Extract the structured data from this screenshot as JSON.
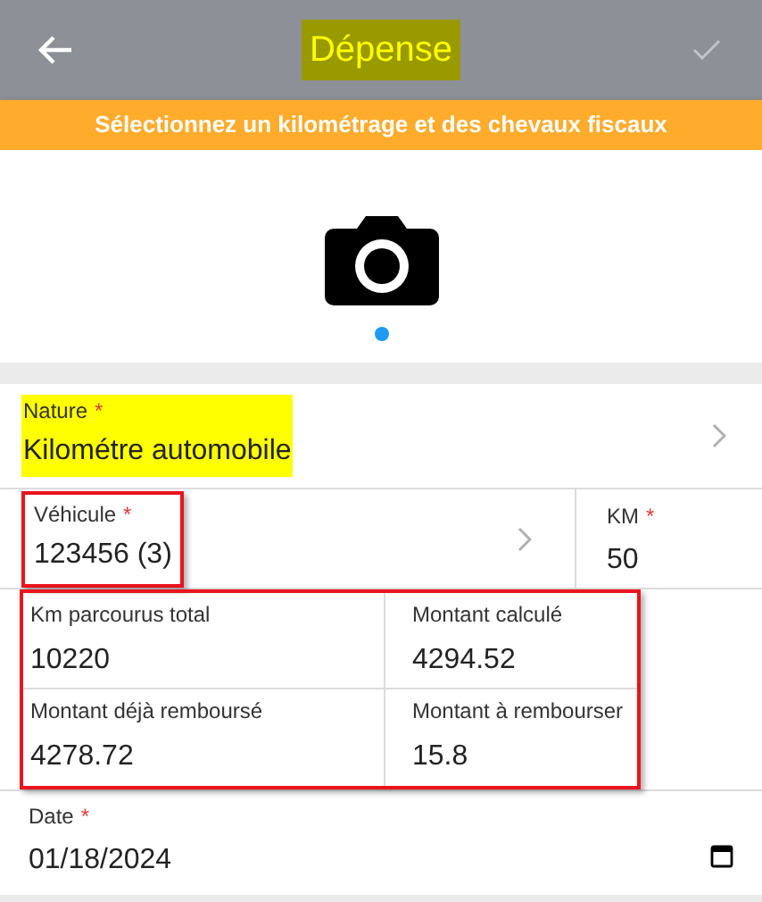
{
  "header": {
    "title": "Dépense",
    "title_highlighted": true,
    "confirm_disabled": true
  },
  "banner": {
    "text": "Sélectionnez un kilométrage et des chevaux fiscaux"
  },
  "photo": {
    "pages": [
      {
        "selected": true
      }
    ]
  },
  "nature": {
    "label": "Nature",
    "required_mark": "*",
    "value": "Kilométre automobile",
    "highlighted": true
  },
  "vehicle": {
    "label": "Véhicule",
    "required_mark": "*",
    "value": "123456 (3)",
    "outlined": true
  },
  "km": {
    "label": "KM",
    "required_mark": "*",
    "value": "50"
  },
  "totals": {
    "outlined": true,
    "cells": [
      {
        "label": "Km parcourus total",
        "value": "10220"
      },
      {
        "label": "Montant calculé",
        "value": "4294.52"
      },
      {
        "label": "Montant déjà remboursé",
        "value": "4278.72"
      },
      {
        "label": "Montant à rembourser",
        "value": "15.8"
      }
    ]
  },
  "date": {
    "label": "Date",
    "required_mark": "*",
    "value": "01/18/2024"
  }
}
